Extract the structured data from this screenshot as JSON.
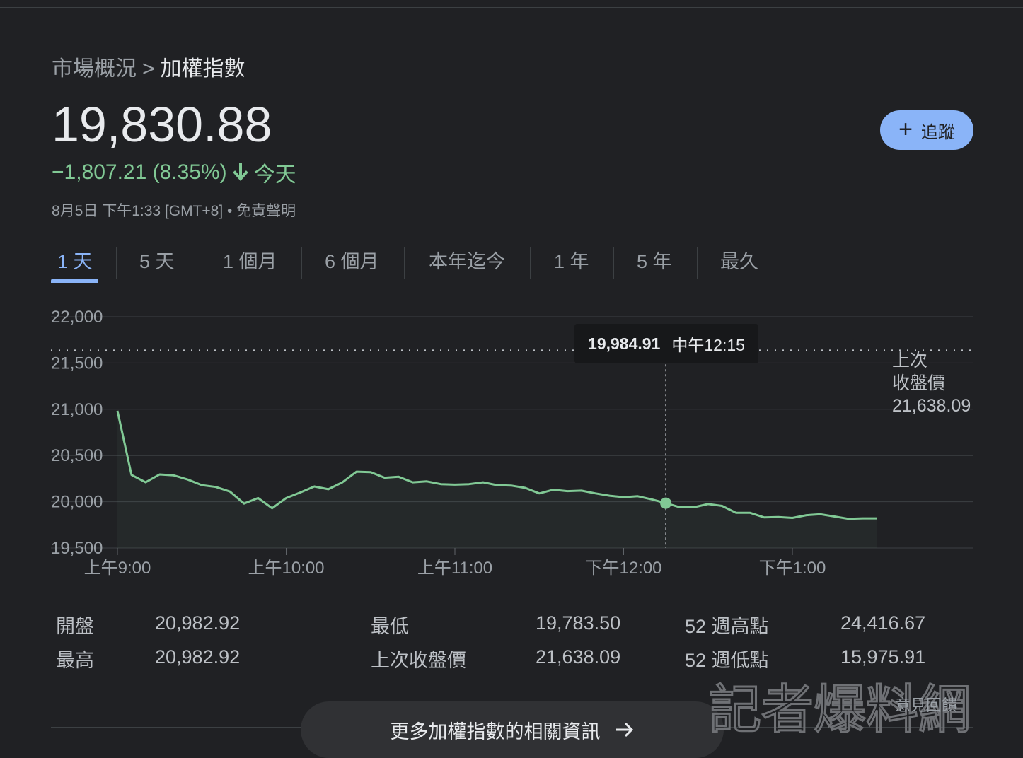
{
  "breadcrumb": {
    "parent": "市場概況",
    "separator": ">",
    "current": "加權指數"
  },
  "quote": {
    "price": "19,830.88",
    "change": "−1,807.21 (8.35%)",
    "change_suffix": "今天",
    "timestamp": "8月5日 下午1:33 [GMT+8] • 免責聲明"
  },
  "follow_button": {
    "label": "追蹤",
    "icon": "plus-icon"
  },
  "tabs": [
    {
      "label": "1 天",
      "active": true
    },
    {
      "label": "5 天"
    },
    {
      "label": "1 個月"
    },
    {
      "label": "6 個月"
    },
    {
      "label": "本年迄今"
    },
    {
      "label": "1 年"
    },
    {
      "label": "5 年"
    },
    {
      "label": "最久"
    }
  ],
  "tooltip": {
    "value": "19,984.91",
    "time": "中午12:15"
  },
  "previous_close": {
    "label_line1": "上次",
    "label_line2": "收盤價",
    "value": "21,638.09"
  },
  "stats": [
    {
      "label": "開盤",
      "value": "20,982.92"
    },
    {
      "label": "最高",
      "value": "20,982.92"
    },
    {
      "label": "最低",
      "value": "19,783.50"
    },
    {
      "label": "上次收盤價",
      "value": "21,638.09"
    },
    {
      "label": "52 週高點",
      "value": "24,416.67"
    },
    {
      "label": "52 週低點",
      "value": "15,975.91"
    }
  ],
  "more_button": {
    "label": "更多加權指數的相關資訊",
    "icon": "arrow-right-icon"
  },
  "watermark": {
    "text": "記者爆料網",
    "feedback": "意見回饋"
  },
  "colors": {
    "accent": "#8ab4f8",
    "line": "#81c995",
    "background": "#202124"
  },
  "chart_data": {
    "type": "line",
    "title": "",
    "y_ticks": [
      "22,000",
      "21,500",
      "21,000",
      "20,500",
      "20,000",
      "19,500"
    ],
    "ylim": [
      19500,
      22000
    ],
    "x_ticks": [
      "上午9:00",
      "上午10:00",
      "上午11:00",
      "下午12:00",
      "下午1:00"
    ],
    "x_tick_minutes": [
      0,
      60,
      120,
      180,
      240
    ],
    "xlim_minutes": [
      0,
      330
    ],
    "reference_line": {
      "label": "上次收盤價",
      "value": 21638.09
    },
    "highlight": {
      "minute": 195,
      "value": 19984.91,
      "time": "中午12:15"
    },
    "series": [
      {
        "x_minutes": [
          0,
          5,
          10,
          15,
          20,
          25,
          30,
          35,
          40,
          45,
          50,
          55,
          60,
          65,
          70,
          75,
          80,
          85,
          90,
          95,
          100,
          105,
          110,
          115,
          120,
          125,
          130,
          135,
          140,
          145,
          150,
          155,
          160,
          165,
          170,
          175,
          180,
          185,
          190,
          195,
          200,
          205,
          210,
          215,
          220,
          225,
          230,
          235,
          240,
          245,
          250,
          255,
          260,
          265,
          270
        ],
        "values": [
          20983,
          20290,
          20210,
          20295,
          20285,
          20240,
          20180,
          20160,
          20110,
          19980,
          20040,
          19930,
          20040,
          20100,
          20165,
          20135,
          20210,
          20325,
          20320,
          20260,
          20270,
          20210,
          20220,
          20190,
          20185,
          20190,
          20210,
          20180,
          20175,
          20150,
          20090,
          20130,
          20115,
          20120,
          20090,
          20065,
          20050,
          20060,
          20025,
          19985,
          19940,
          19940,
          19975,
          19955,
          19880,
          19880,
          19830,
          19835,
          19825,
          19855,
          19865,
          19840,
          19815,
          19820,
          19820
        ]
      }
    ]
  }
}
